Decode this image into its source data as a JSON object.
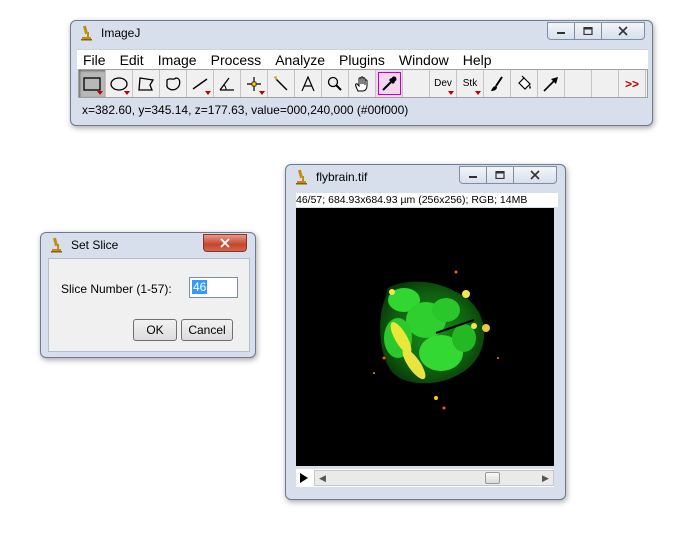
{
  "main_window": {
    "title": "ImageJ",
    "menus": [
      "File",
      "Edit",
      "Image",
      "Process",
      "Analyze",
      "Plugins",
      "Window",
      "Help"
    ],
    "tools": {
      "dev_label": "Dev",
      "stk_label": "Stk",
      "more_label": ">>"
    },
    "status": "x=382.60, y=345.14, z=177.63, value=000,240,000 (#00f000)"
  },
  "image_window": {
    "title": "flybrain.tif",
    "info": "46/57; 684.93x684.93 µm (256x256); RGB; 14MB"
  },
  "dialog": {
    "title": "Set Slice",
    "label": "Slice Number (1-57):",
    "value": "46",
    "ok_label": "OK",
    "cancel_label": "Cancel"
  },
  "colors": {
    "accent_selection": "#3399ff",
    "close_button": "#c3452e",
    "title_bg": "#d6dfeb",
    "picker_highlight": "#c000c0",
    "fluorescence_green": "#2ed12e",
    "fluorescence_yellow": "#f2e84a"
  },
  "icons": {
    "app": "microscope-icon",
    "tools": [
      "rectangle-icon",
      "oval-icon",
      "polygon-icon",
      "freehand-icon",
      "line-icon",
      "angle-icon",
      "point-icon",
      "wand-icon",
      "text-icon",
      "magnifier-icon",
      "hand-icon",
      "color-picker-icon",
      "brush-icon",
      "flood-fill-icon",
      "arrow-icon"
    ]
  }
}
